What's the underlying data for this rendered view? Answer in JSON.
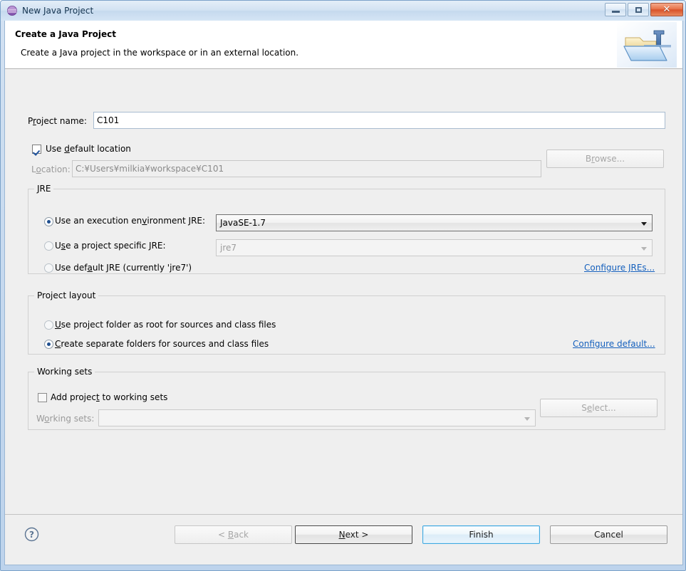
{
  "window": {
    "title": "New Java Project",
    "icon": "eclipse-wizard-icon",
    "buttons": {
      "minimize": "minimize-icon",
      "maximize": "maximize-icon",
      "close": "✕"
    }
  },
  "header": {
    "title": "Create a Java Project",
    "description": "Create a Java project in the workspace or in an external location.",
    "icon": "java-project-folder-icon"
  },
  "project": {
    "name_label_pre": "P",
    "name_label_mnemonic": "r",
    "name_label_post": "oject name:",
    "name_value": "C101",
    "use_default_location_pre": "Use ",
    "use_default_location_mnemonic": "d",
    "use_default_location_post": "efault location",
    "use_default_location_checked": true,
    "location_label_pre": "L",
    "location_label_mnemonic": "o",
    "location_label_post": "cation:",
    "location_value": "C:¥Users¥milkia¥workspace¥C101",
    "browse_label_pre": "B",
    "browse_label_mnemonic": "r",
    "browse_label_post": "owse..."
  },
  "jre": {
    "group_title": "JRE",
    "option_env_pre": "Use an execution en",
    "option_env_mnemonic": "v",
    "option_env_post": "ironment JRE:",
    "option_env_selected": true,
    "env_value": "JavaSE-1.7",
    "option_specific_pre": "U",
    "option_specific_mnemonic": "s",
    "option_specific_post": "e a project specific JRE:",
    "option_specific_selected": false,
    "specific_value": "jre7",
    "option_default_pre": "Use def",
    "option_default_mnemonic": "a",
    "option_default_post": "ult JRE (currently 'jre7')",
    "option_default_selected": false,
    "configure_link": "Configure JREs..."
  },
  "layout": {
    "group_title": "Project layout",
    "option_root_pre": "",
    "option_root_mnemonic": "U",
    "option_root_post": "se project folder as root for sources and class files",
    "option_root_selected": false,
    "option_separate_pre": "",
    "option_separate_mnemonic": "C",
    "option_separate_post": "reate separate folders for sources and class files",
    "option_separate_selected": true,
    "configure_link": "Configure default..."
  },
  "working_sets": {
    "group_title": "Working sets",
    "add_label_pre": "Add projec",
    "add_label_mnemonic": "t",
    "add_label_post": " to working sets",
    "add_checked": false,
    "sets_label_pre": "W",
    "sets_label_mnemonic": "o",
    "sets_label_post": "rking sets:",
    "sets_value": "",
    "select_label_pre": "S",
    "select_label_mnemonic": "e",
    "select_label_post": "lect..."
  },
  "footer": {
    "help_icon": "help-circle-icon",
    "back_pre": "< ",
    "back_mnemonic": "B",
    "back_post": "ack",
    "back_enabled": false,
    "next_pre": "",
    "next_mnemonic": "N",
    "next_post": "ext >",
    "finish": "Finish",
    "cancel": "Cancel"
  },
  "colors": {
    "link": "#1560bd",
    "accent": "#3fa9e0",
    "dialog_bg": "#efefef",
    "header_bg": "#ffffff"
  }
}
